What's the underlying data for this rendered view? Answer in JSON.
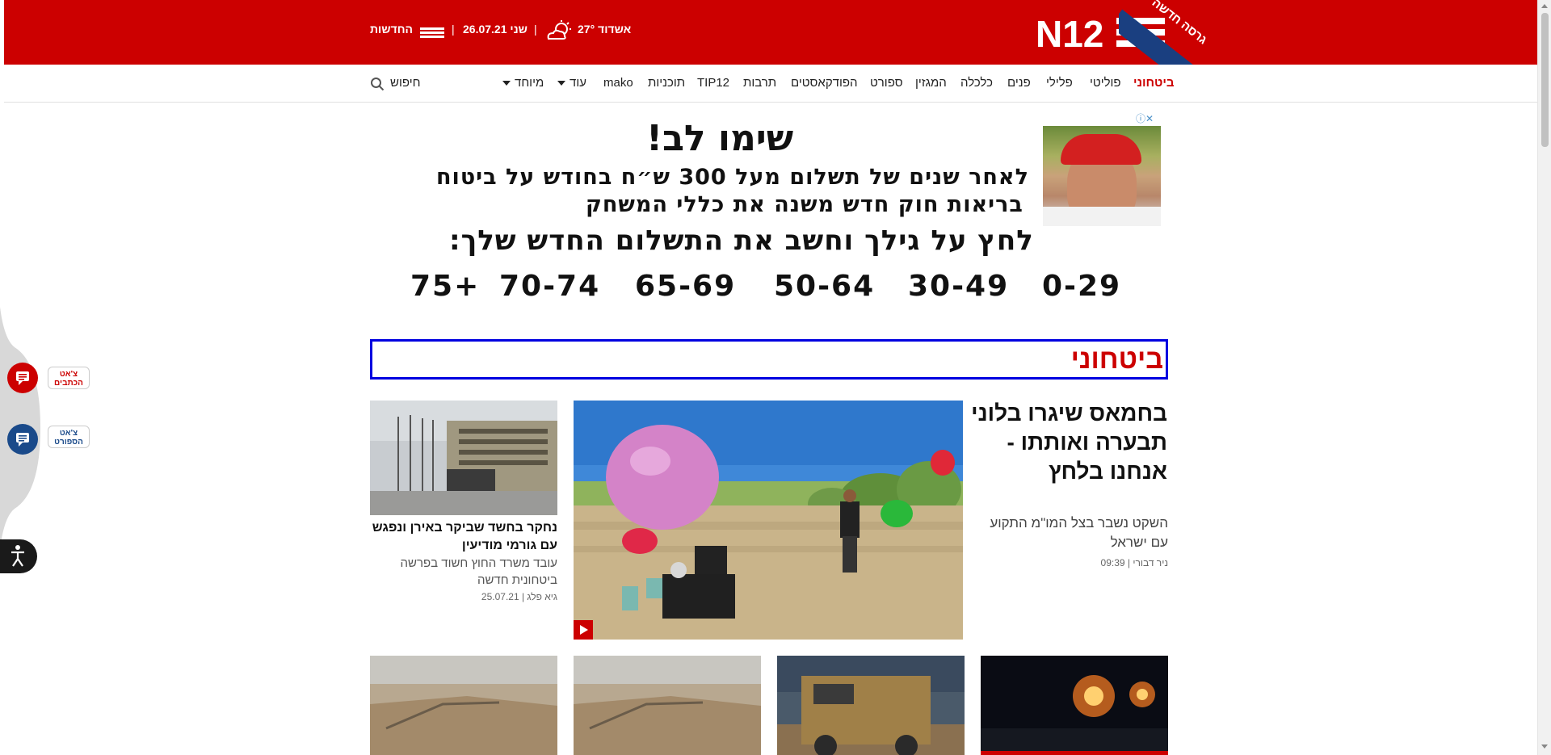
{
  "header": {
    "logo_text": "N12",
    "ribbon": "גרסה חדשה",
    "weather": "אשדוד 27°",
    "date": "שני 26.07.21",
    "news_menu": "החדשות",
    "separator": "|"
  },
  "nav": {
    "items": [
      {
        "label": "ביטחוני",
        "active": true
      },
      {
        "label": "פוליטי"
      },
      {
        "label": "פלילי"
      },
      {
        "label": "פנים"
      },
      {
        "label": "כלכלה"
      },
      {
        "label": "המגזין"
      },
      {
        "label": "ספורט"
      },
      {
        "label": "הפודקאסטים"
      },
      {
        "label": "תרבות"
      },
      {
        "label": "TIP12"
      },
      {
        "label": "תוכניות"
      },
      {
        "label": "mako"
      },
      {
        "label": "עוד"
      },
      {
        "label": "מיוחד"
      }
    ],
    "search_label": "חיפוש"
  },
  "ad": {
    "close": "ⓘ✕",
    "title": "שימו לב!",
    "line1": "לאחר שנים של תשלום מעל 300 ש״ח בחודש על ביטוח",
    "line2": "בריאות חוק חדש משנה את כללי המשחק",
    "line3": "לחץ על גילך וחשב את התשלום החדש שלך:",
    "ages": [
      "0-29",
      "30-49",
      "50-64",
      "65-69",
      "70-74",
      "75+"
    ]
  },
  "section": {
    "title": "ביטחוני"
  },
  "main_article": {
    "title": "בחמאס שיגרו בלוני תבערה ואותתו - אנחנו בלחץ",
    "subtitle": "השקט נשבר בצל המו\"מ התקוע עם ישראל",
    "meta": "ניר דבורי | 09:39"
  },
  "side_article": {
    "title": "נחקר בחשד שביקר באירן ונפגש עם גורמי מודיעין",
    "subtitle": "עובד משרד החוץ חשוד בפרשה ביטחונית חדשה",
    "meta": "גיא פלג | 25.07.21"
  },
  "widgets": {
    "chat_writers": "צ'אט הכתבים",
    "chat_sport": "צ'אט הספורט"
  },
  "colors": {
    "brand_red": "#cc0000",
    "ribbon_blue": "#1a3f80",
    "section_border": "#0000e0",
    "sport_blue": "#1a4a8a"
  }
}
